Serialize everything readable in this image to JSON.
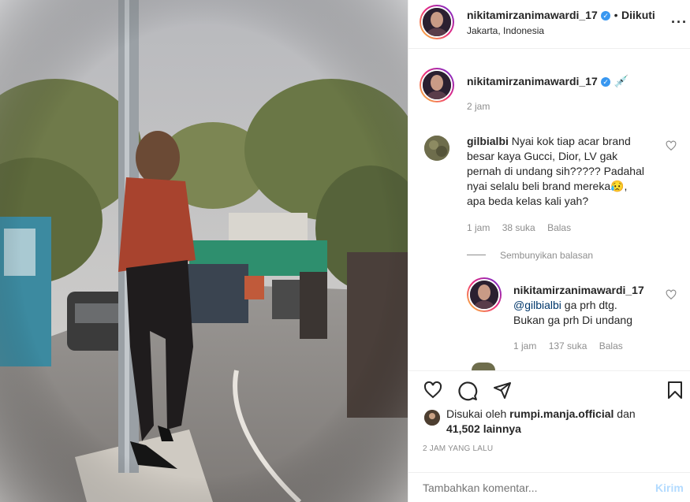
{
  "header": {
    "username": "nikitamirzanimawardi_17",
    "follow_label": "Diikuti",
    "location": "Jakarta, Indonesia",
    "more_icon": "more-dots-icon"
  },
  "caption": {
    "username": "nikitamirzanimawardi_17",
    "emoji": "💉",
    "time": "2 jam"
  },
  "comments": [
    {
      "username": "gilbialbi",
      "text_lines": [
        "Nyai kok tiap acar brand",
        "besar kaya Gucci, Dior, LV gak",
        "pernah di undang sih????? Padahal",
        "nyai selalu beli brand mereka😥,",
        "apa beda kelas kali yah?"
      ],
      "time": "1 jam",
      "likes": "38 suka",
      "reply_label": "Balas",
      "hide_replies": "Sembunyikan balasan"
    }
  ],
  "reply": {
    "username": "nikitamirzanimawardi_17",
    "mention": "@gilbialbi",
    "text_line1": " ga prh dtg.",
    "text_line2": "Bukan ga prh Di undang",
    "time": "1 jam",
    "likes": "137 suka",
    "reply_label": "Balas"
  },
  "actions": {
    "like_icon": "heart-icon",
    "comment_icon": "comment-icon",
    "share_icon": "share-icon",
    "save_icon": "bookmark-icon"
  },
  "likes": {
    "prefix": "Disukai oleh ",
    "user": "rumpi.manja.official",
    "mid": " dan",
    "count": "41,502 lainnya"
  },
  "timestamp": "2 JAM YANG LALU",
  "comment_box": {
    "placeholder": "Tambahkan komentar...",
    "post_label": "Kirim"
  }
}
